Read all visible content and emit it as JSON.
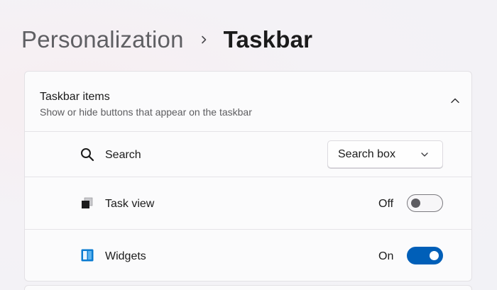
{
  "breadcrumb": {
    "parent": "Personalization",
    "separator_icon": "chevron-right-icon",
    "current": "Taskbar"
  },
  "taskbar_items": {
    "title": "Taskbar items",
    "subtitle": "Show or hide buttons that appear on the taskbar",
    "collapse_icon": "chevron-up-icon",
    "rows": [
      {
        "icon": "search-icon",
        "label": "Search",
        "control": "dropdown",
        "value": "Search box"
      },
      {
        "icon": "task-view-icon",
        "label": "Task view",
        "control": "toggle",
        "state_label": "Off",
        "on": false
      },
      {
        "icon": "widgets-icon",
        "label": "Widgets",
        "control": "toggle",
        "state_label": "On",
        "on": true
      }
    ]
  },
  "colors": {
    "accent": "#005fb8",
    "widgets_icon": "#0a7bd1",
    "background": "#f3f1f5",
    "card": "#fbfbfc"
  }
}
